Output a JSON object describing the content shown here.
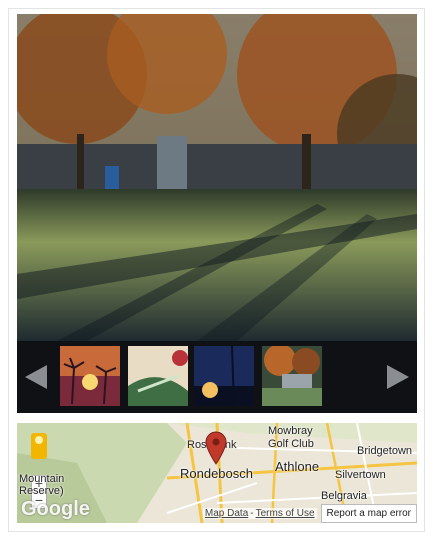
{
  "gallery": {
    "prev_label": "",
    "next_label": "",
    "thumbnails": [
      {
        "name": "sunset-palms"
      },
      {
        "name": "green-fabric"
      },
      {
        "name": "night-sky-pole"
      },
      {
        "name": "autumn-tree-building"
      }
    ]
  },
  "map": {
    "places": {
      "mowbray": "Mowbray",
      "golf_club": "Golf Club",
      "rosebank": "Rosebank",
      "rondebosch": "Rondebosch",
      "athlone": "Athlone",
      "bridgetown": "Bridgetown",
      "silvertown": "Silvertown",
      "belgravia": "Belgravia",
      "reserve_a": "Mountain",
      "reserve_b": "Reserve)"
    },
    "zoom_in": "+",
    "zoom_out": "−",
    "google": "Google",
    "map_data": "Map Data",
    "separator": "-",
    "terms": "Terms of Use",
    "report": "Report a map error"
  },
  "colors": {
    "pin": "#c0392b",
    "pegman": "#f2b500"
  }
}
